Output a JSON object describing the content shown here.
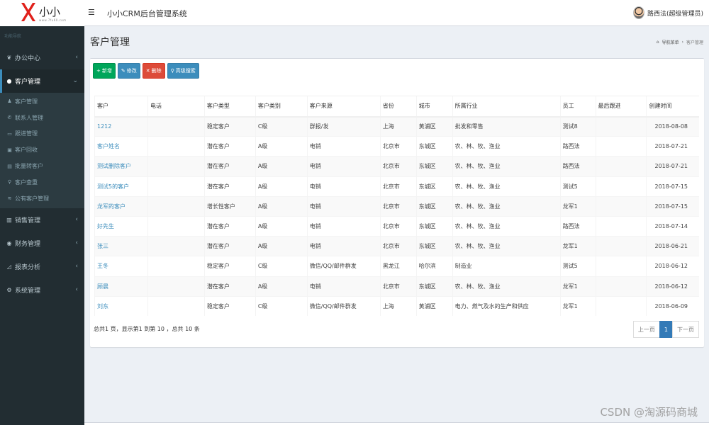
{
  "header": {
    "brand": "小小",
    "brand_sub": "www.7fu60.com",
    "title": "小小CRM后台管理系统",
    "user": "路西法(超级管理员)",
    "toggle_icon": "☰"
  },
  "sidebar": {
    "section_label": "功能导航",
    "items": [
      {
        "label": "办公中心",
        "icon": "leaf-icon"
      },
      {
        "label": "客户管理",
        "icon": "user-icon",
        "active": true
      },
      {
        "label": "销售管理",
        "icon": "bar-chart-icon"
      },
      {
        "label": "财务管理",
        "icon": "coin-icon"
      },
      {
        "label": "报表分析",
        "icon": "line-chart-icon"
      },
      {
        "label": "系统管理",
        "icon": "gear-icon"
      }
    ],
    "sub_items": [
      {
        "label": "客户管理",
        "icon": "user-icon"
      },
      {
        "label": "联系人管理",
        "icon": "phone-icon"
      },
      {
        "label": "跟进管理",
        "icon": "folder-icon"
      },
      {
        "label": "客户回收",
        "icon": "recycle-icon"
      },
      {
        "label": "批量转客户",
        "icon": "transfer-icon"
      },
      {
        "label": "客户查重",
        "icon": "search-icon"
      },
      {
        "label": "公有客户管理",
        "icon": "wifi-icon"
      }
    ]
  },
  "page": {
    "title": "客户管理",
    "breadcrumb": [
      "导航菜单",
      "客户管理"
    ]
  },
  "toolbar": {
    "add": "新增",
    "edit": "修改",
    "delete": "删除",
    "search": "高级搜索"
  },
  "table": {
    "columns": [
      "客户",
      "电话",
      "客户类型",
      "客户类别",
      "客户来源",
      "省份",
      "城市",
      "所属行业",
      "员工",
      "最后跟进",
      "创建时间"
    ],
    "rows": [
      [
        "1212",
        "",
        "稳定客户",
        "C级",
        "群报/发",
        "上海",
        "黄浦区",
        "批发和零售",
        "测试8",
        "",
        "2018-08-08"
      ],
      [
        "客户姓名",
        "",
        "潜在客户",
        "A级",
        "电销",
        "北京市",
        "东城区",
        "农、林、牧、渔业",
        "路西法",
        "",
        "2018-07-21"
      ],
      [
        "测试删除客户",
        "",
        "潜在客户",
        "A级",
        "电销",
        "北京市",
        "东城区",
        "农、林、牧、渔业",
        "路西法",
        "",
        "2018-07-21"
      ],
      [
        "测试5的客户",
        "",
        "潜在客户",
        "A级",
        "电销",
        "北京市",
        "东城区",
        "农、林、牧、渔业",
        "测试5",
        "",
        "2018-07-15"
      ],
      [
        "龙军的客户",
        "",
        "增长性客户",
        "A级",
        "电销",
        "北京市",
        "东城区",
        "农、林、牧、渔业",
        "龙军1",
        "",
        "2018-07-15"
      ],
      [
        "好先生",
        "",
        "潜在客户",
        "A级",
        "电销",
        "北京市",
        "东城区",
        "农、林、牧、渔业",
        "路西法",
        "",
        "2018-07-14"
      ],
      [
        "张三",
        "",
        "潜在客户",
        "A级",
        "电销",
        "北京市",
        "东城区",
        "农、林、牧、渔业",
        "龙军1",
        "",
        "2018-06-21"
      ],
      [
        "王冬",
        "",
        "稳定客户",
        "C级",
        "微信/QQ/邮件群发",
        "黑龙江",
        "哈尔滨",
        "制造业",
        "测试5",
        "",
        "2018-06-12"
      ],
      [
        "顾晨",
        "",
        "潜在客户",
        "A级",
        "电销",
        "北京市",
        "东城区",
        "农、林、牧、渔业",
        "龙军1",
        "",
        "2018-06-12"
      ],
      [
        "刘东",
        "",
        "稳定客户",
        "C级",
        "微信/QQ/邮件群发",
        "上海",
        "黄浦区",
        "电力、燃气及水的生产和供应",
        "龙军1",
        "",
        "2018-06-09"
      ]
    ]
  },
  "pagination": {
    "info": "总共1 页，显示第1 到第 10 ，总共 10 条",
    "prev": "上一页",
    "current": "1",
    "next": "下一页"
  },
  "watermark": "CSDN @淘源码商城",
  "colors": {
    "sidebar": "#222d32",
    "accent": "#3c8dbc",
    "success": "#00a65a",
    "danger": "#dd4b39"
  }
}
